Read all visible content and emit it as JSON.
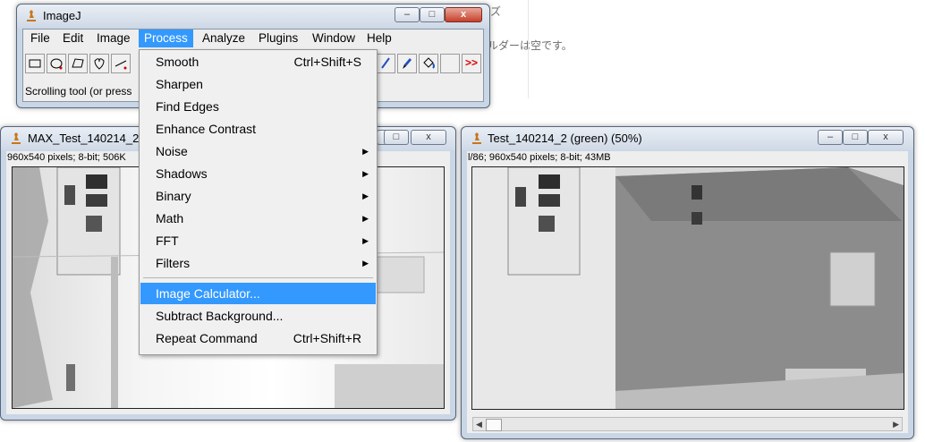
{
  "background": {
    "hint_top": "ズ",
    "hint_empty": "ルダーは空です。"
  },
  "imagej": {
    "title": "ImageJ",
    "menus": [
      "File",
      "Edit",
      "Image",
      "Process",
      "Analyze",
      "Plugins",
      "Window",
      "Help"
    ],
    "active_menu": "Process",
    "status": "Scrolling tool (or press",
    "more_tools": ">>"
  },
  "process_menu": [
    {
      "label": "Smooth",
      "shortcut": "Ctrl+Shift+S"
    },
    {
      "label": "Sharpen",
      "shortcut": ""
    },
    {
      "label": "Find Edges",
      "shortcut": ""
    },
    {
      "label": "Enhance Contrast",
      "shortcut": ""
    },
    {
      "label": "Noise",
      "submenu": true
    },
    {
      "label": "Shadows",
      "submenu": true
    },
    {
      "label": "Binary",
      "submenu": true
    },
    {
      "label": "Math",
      "submenu": true
    },
    {
      "label": "FFT",
      "submenu": true
    },
    {
      "label": "Filters",
      "submenu": true
    },
    {
      "label": "Image Calculator...",
      "highlighted": true
    },
    {
      "label": "Subtract Background..."
    },
    {
      "label": "Repeat Command",
      "shortcut": "Ctrl+Shift+R"
    }
  ],
  "left_window": {
    "title": "MAX_Test_140214_2",
    "info": "960x540 pixels; 8-bit; 506K"
  },
  "right_window": {
    "title": "Test_140214_2 (green) (50%)",
    "info": "l/86; 960x540 pixels; 8-bit; 43MB"
  },
  "controls": {
    "minimize": "▭",
    "maximize": "□",
    "close": "x"
  }
}
